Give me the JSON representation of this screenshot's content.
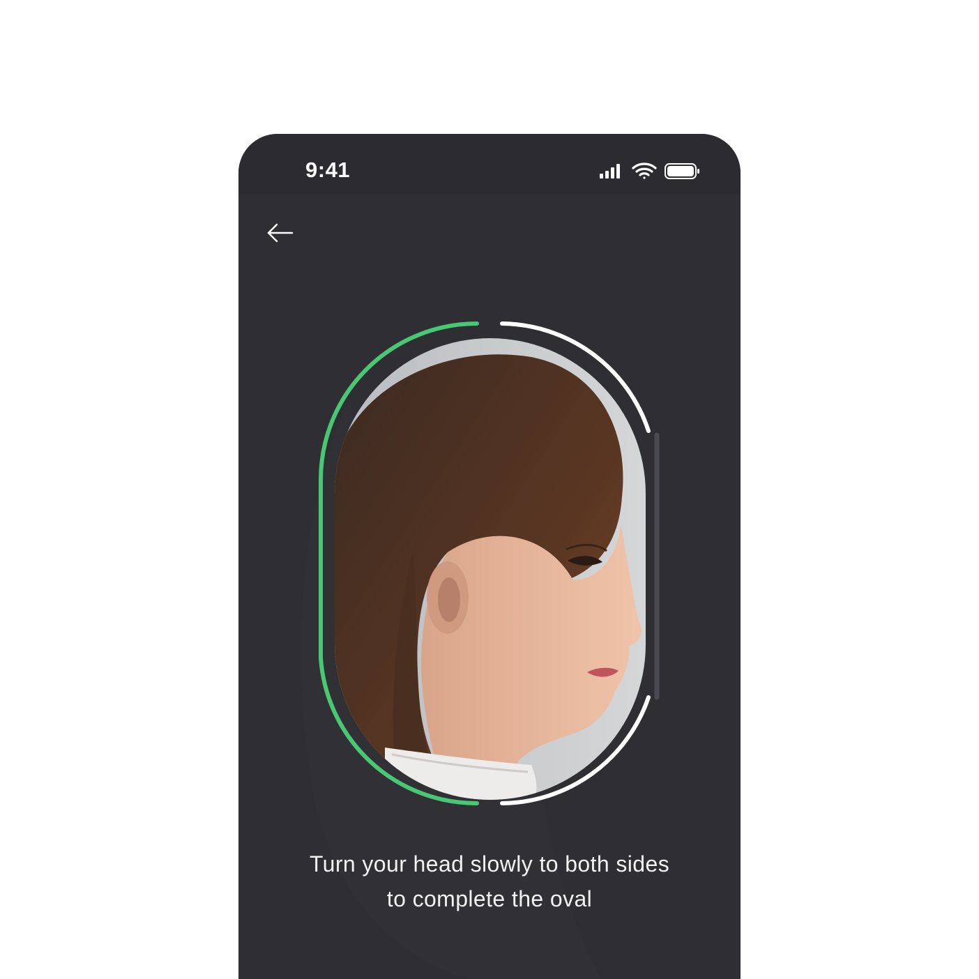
{
  "status_bar": {
    "time": "9:41",
    "icons": [
      "cellular-signal-icon",
      "wifi-icon",
      "battery-icon"
    ]
  },
  "nav": {
    "back_icon": "arrow-left-icon"
  },
  "face_capture": {
    "progress_color": "#48c774",
    "remaining_color": "#ffffff",
    "track_color": "#4a4a52",
    "left_side_complete": true,
    "right_side_complete": false
  },
  "instruction": {
    "line1": "Turn your head slowly to both sides",
    "line2": "to complete the oval"
  },
  "colors": {
    "screen_background": "#2e2e33",
    "page_background": "#ffffff"
  }
}
